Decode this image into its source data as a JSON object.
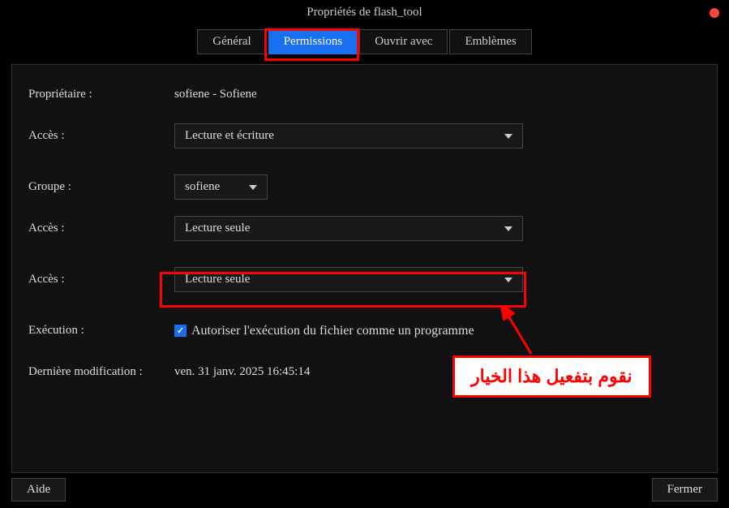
{
  "window": {
    "title": "Propriétés de flash_tool"
  },
  "tabs": {
    "general": "Général",
    "permissions": "Permissions",
    "open_with": "Ouvrir avec",
    "emblems": "Emblèmes"
  },
  "form": {
    "owner_label": "Propriétaire :",
    "owner_value": "sofiene - Sofiene",
    "access_label": "Accès :",
    "owner_access": "Lecture et écriture",
    "group_label": "Groupe :",
    "group_value": "sofiene",
    "group_access": "Lecture seule",
    "others_access": "Lecture seule",
    "execution_label": "Exécution :",
    "execution_checkbox": "Autoriser l'exécution du fichier comme un programme",
    "last_mod_label": "Dernière modification :",
    "last_mod_value": "ven. 31 janv. 2025 16:45:14"
  },
  "buttons": {
    "help": "Aide",
    "close": "Fermer"
  },
  "annotation": {
    "text": "نقوم بتفعيل هذا الخيار"
  }
}
